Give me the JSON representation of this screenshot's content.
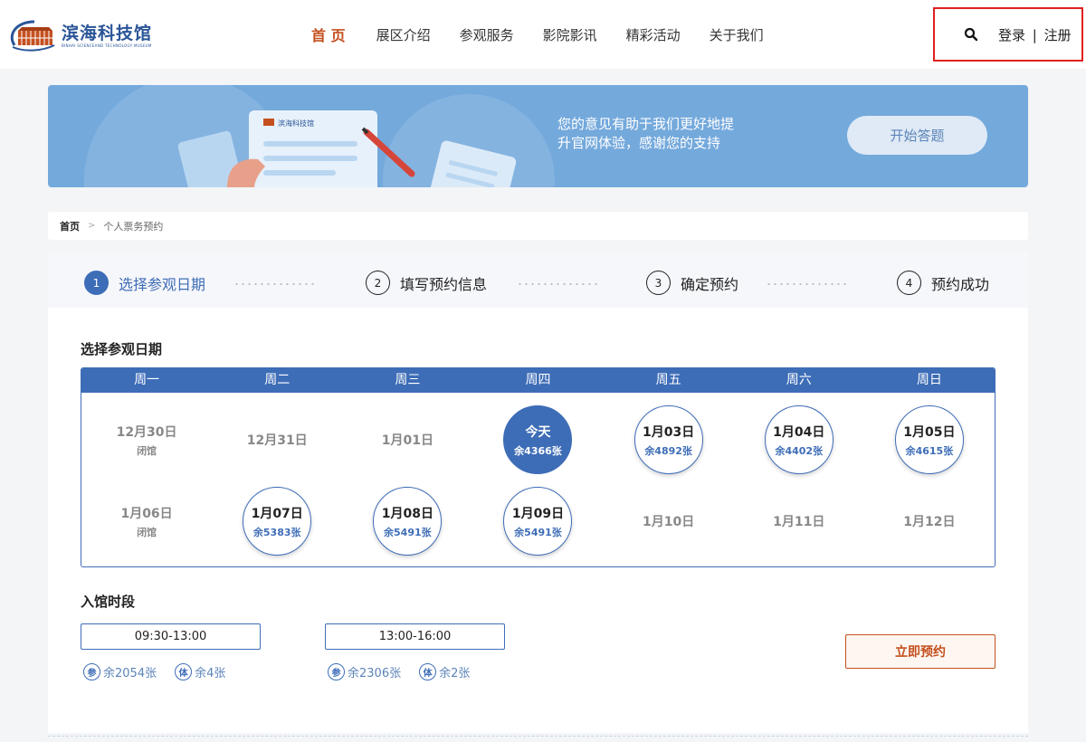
{
  "brand": {
    "name": "滨海科技馆",
    "subtitle": "BINHAI SCIENCEAND TECHNOLOGY MUSEUM",
    "colors": {
      "primary": "#3e6db7",
      "accent": "#c4501f",
      "logo_orange": "#c4501f"
    }
  },
  "nav": {
    "items": [
      "首 页",
      "展区介绍",
      "参观服务",
      "影院影讯",
      "精彩活动",
      "关于我们"
    ],
    "active_index": 0
  },
  "header": {
    "search_icon": "search-icon",
    "login": "登录",
    "separator": "|",
    "register": "注册"
  },
  "banner": {
    "line1": "您的意见有助于我们更好地提",
    "line2": "升官网体验，感谢您的支持",
    "button": "开始答题",
    "card_logo": "滨海科技馆"
  },
  "breadcrumb": {
    "home": "首页",
    "separator": ">",
    "current": "个人票务预约"
  },
  "steps": [
    {
      "num": "1",
      "label": "选择参观日期",
      "active": true
    },
    {
      "num": "2",
      "label": "填写预约信息",
      "active": false
    },
    {
      "num": "3",
      "label": "确定预约",
      "active": false
    },
    {
      "num": "4",
      "label": "预约成功",
      "active": false
    }
  ],
  "date_section": {
    "title": "选择参观日期",
    "weekdays": [
      "周一",
      "周二",
      "周三",
      "周四",
      "周五",
      "周六",
      "周日"
    ],
    "rows": [
      [
        {
          "date": "12月30日",
          "note": "闭馆",
          "status": "closed"
        },
        {
          "date": "12月31日",
          "note": "",
          "status": "past"
        },
        {
          "date": "1月01日",
          "note": "",
          "status": "past"
        },
        {
          "date": "今天",
          "note": "余4366张",
          "status": "today"
        },
        {
          "date": "1月03日",
          "note": "余4892张",
          "status": "available"
        },
        {
          "date": "1月04日",
          "note": "余4402张",
          "status": "available"
        },
        {
          "date": "1月05日",
          "note": "余4615张",
          "status": "available"
        }
      ],
      [
        {
          "date": "1月06日",
          "note": "闭馆",
          "status": "closed"
        },
        {
          "date": "1月07日",
          "note": "余5383张",
          "status": "available"
        },
        {
          "date": "1月08日",
          "note": "余5491张",
          "status": "available"
        },
        {
          "date": "1月09日",
          "note": "余5491张",
          "status": "available"
        },
        {
          "date": "1月10日",
          "note": "",
          "status": "unavailable"
        },
        {
          "date": "1月11日",
          "note": "",
          "status": "unavailable"
        },
        {
          "date": "1月12日",
          "note": "",
          "status": "unavailable"
        }
      ]
    ]
  },
  "time_section": {
    "title": "入馆时段",
    "slots": [
      {
        "time": "09:30-13:00",
        "visit_badge": "参",
        "visit_left": "余2054张",
        "exp_badge": "体",
        "exp_left": "余4张"
      },
      {
        "time": "13:00-16:00",
        "visit_badge": "参",
        "visit_left": "余2306张",
        "exp_badge": "体",
        "exp_left": "余2张"
      }
    ],
    "book_button": "立即预约"
  }
}
